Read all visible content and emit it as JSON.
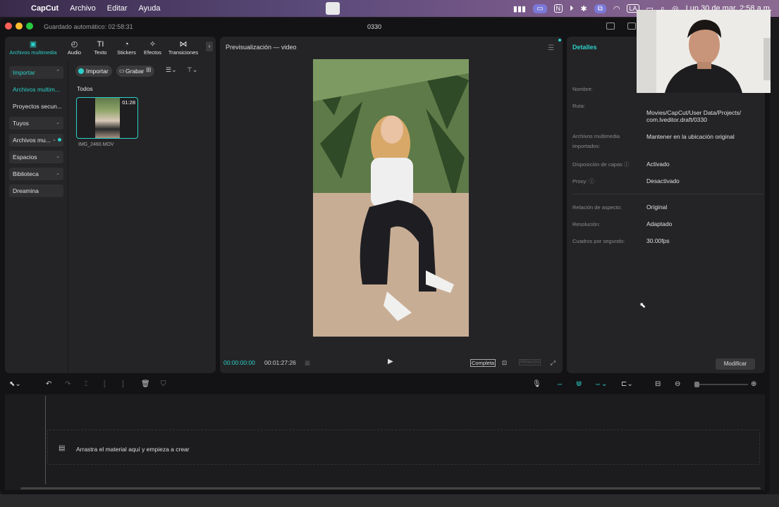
{
  "menubar": {
    "app_name": "CapCut",
    "menus": [
      "Archivo",
      "Editar",
      "Ayuda"
    ],
    "layout_indicator": "LA",
    "clock": "Lun 30 de mar.  2:58 a.m."
  },
  "window": {
    "autosave": "Guardado automático: 02:58:31",
    "project_name": "0330"
  },
  "toolbar": {
    "tools": [
      {
        "label": "Archivos multimedia",
        "icon": "media-icon",
        "active": true
      },
      {
        "label": "Audio",
        "icon": "audio-icon"
      },
      {
        "label": "Texto",
        "icon": "text-icon"
      },
      {
        "label": "Stickers",
        "icon": "sticker-icon"
      },
      {
        "label": "Efectos",
        "icon": "effects-icon"
      },
      {
        "label": "Transiciones",
        "icon": "transitions-icon"
      }
    ]
  },
  "sidenav": {
    "items": [
      {
        "label": "Importar",
        "style": "boxed-teal",
        "chevron": true
      },
      {
        "label": "Archivos multim...",
        "style": "teal"
      },
      {
        "label": "Proyectos secun...",
        "style": "plain"
      },
      {
        "label": "Tuyos",
        "style": "boxed",
        "chevron": true
      },
      {
        "label": "Archivos mu...",
        "style": "boxed",
        "chevron": true,
        "dot": true
      },
      {
        "label": "Espacios",
        "style": "boxed",
        "chevron": true
      },
      {
        "label": "Biblioteca",
        "style": "boxed",
        "chevron": true
      },
      {
        "label": "Dreamina",
        "style": "boxed"
      }
    ]
  },
  "media": {
    "import_label": "Importar",
    "record_label": "Grabar",
    "filter_label": "Todos",
    "clips": [
      {
        "name": "IMG_2460.MOV",
        "duration": "01:28"
      }
    ]
  },
  "preview": {
    "title": "Previsualización — video",
    "current_time": "00:00:00:00",
    "total_time": "00:01:27:26",
    "ratio_label": "Completa",
    "ratio_label2": "Relación"
  },
  "details": {
    "title": "Detalles",
    "rows": [
      {
        "label": "Nombre:",
        "value": ""
      },
      {
        "label": "Ruta:",
        "value": ""
      },
      {
        "label": "",
        "value": "Movies/CapCut/User Data/Projects/ com.lveditor.draft/0330"
      },
      {
        "label": "Archivos multimedia importados:",
        "value": "Mantener en la ubicación original"
      },
      {
        "label": "Disposición de capas",
        "value": "Activado"
      },
      {
        "label": "Proxy:",
        "value": "Desactivado"
      },
      {
        "label": "Relación de aspecto:",
        "value": "Original"
      },
      {
        "label": "Resolución:",
        "value": "Adaptado"
      },
      {
        "label": "Cuadros por segundo:",
        "value": "30.00fps"
      }
    ],
    "modify_label": "Modificar"
  },
  "timeline": {
    "drop_text": "Arrastra el material aquí y empieza a crear"
  },
  "colors": {
    "accent": "#2bd0c8",
    "panel": "#242426",
    "background": "#131315"
  }
}
